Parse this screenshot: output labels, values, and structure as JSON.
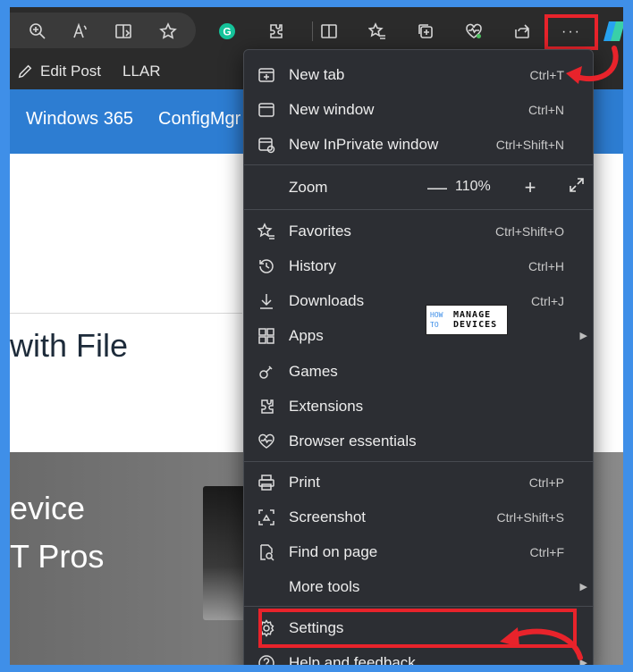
{
  "toolbar": {
    "more_label": "···",
    "icons": [
      "zoom-in-icon",
      "read-aloud-icon",
      "immersive-reader-icon",
      "favorite-star-icon",
      "grammarly-icon",
      "extensions-icon",
      "split-screen-icon",
      "favorites-icon",
      "collections-icon",
      "browser-essentials-icon",
      "share-icon",
      "more-icon",
      "copilot-icon"
    ]
  },
  "favorites_bar": {
    "items": [
      {
        "label": "Edit Post",
        "icon": "pencil-icon"
      },
      {
        "label": "LLAR"
      }
    ]
  },
  "site_nav": {
    "items": [
      "Windows 365",
      "ConfigMgr"
    ]
  },
  "page": {
    "title_fragment": "with File",
    "hero_line1": "evice",
    "hero_line2": "T Pros"
  },
  "menu": {
    "items_top": [
      {
        "label": "New tab",
        "shortcut": "Ctrl+T",
        "icon": "new-tab-icon"
      },
      {
        "label": "New window",
        "shortcut": "Ctrl+N",
        "icon": "new-window-icon"
      },
      {
        "label": "New InPrivate window",
        "shortcut": "Ctrl+Shift+N",
        "icon": "inprivate-icon"
      }
    ],
    "zoom": {
      "label": "Zoom",
      "value": "110%",
      "minus": "—",
      "plus": "+"
    },
    "items_mid": [
      {
        "label": "Favorites",
        "shortcut": "Ctrl+Shift+O",
        "icon": "favorites-icon"
      },
      {
        "label": "History",
        "shortcut": "Ctrl+H",
        "icon": "history-icon"
      },
      {
        "label": "Downloads",
        "shortcut": "Ctrl+J",
        "icon": "download-icon"
      },
      {
        "label": "Apps",
        "shortcut": "",
        "icon": "apps-icon",
        "submenu": true
      },
      {
        "label": "Games",
        "shortcut": "",
        "icon": "games-icon"
      },
      {
        "label": "Extensions",
        "shortcut": "",
        "icon": "extensions-icon"
      },
      {
        "label": "Browser essentials",
        "shortcut": "",
        "icon": "heart-pulse-icon"
      }
    ],
    "items_bottom": [
      {
        "label": "Print",
        "shortcut": "Ctrl+P",
        "icon": "printer-icon"
      },
      {
        "label": "Screenshot",
        "shortcut": "Ctrl+Shift+S",
        "icon": "screenshot-icon"
      },
      {
        "label": "Find on page",
        "shortcut": "Ctrl+F",
        "icon": "find-icon"
      },
      {
        "label": "More tools",
        "shortcut": "",
        "icon": "",
        "submenu": true
      },
      {
        "label": "Settings",
        "shortcut": "",
        "icon": "gear-icon"
      },
      {
        "label": "Help and feedback",
        "shortcut": "",
        "icon": "help-icon",
        "submenu": true
      }
    ],
    "submenu_arrow": "▶"
  },
  "watermark": {
    "line_a1": "HOW",
    "line_a2": "TO",
    "line_b1": "MANAGE",
    "line_b2": "DEVICES"
  },
  "colors": {
    "highlight": "#e8232b",
    "accent_nav": "#2d7dd2",
    "menu_bg": "#2c2e33",
    "border": "#3f8fe8"
  }
}
